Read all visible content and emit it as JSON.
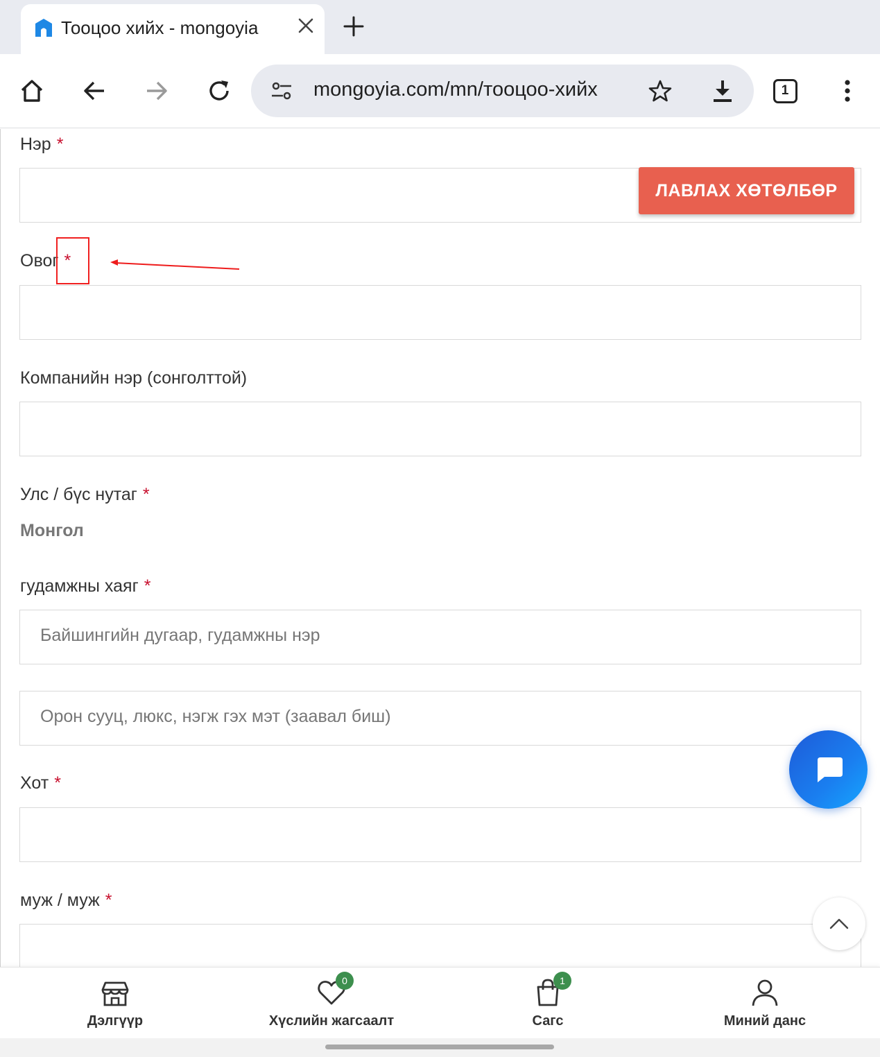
{
  "browser": {
    "tab_title": "Тооцоо хийх - mongoyia",
    "url": "mongoyia.com/mn/тооцоо-хийх",
    "tab_count": "1"
  },
  "form": {
    "first_name_label": "Нэр",
    "required_mark": "*",
    "reference_button": "ЛАВЛАХ ХӨТӨЛБӨР",
    "last_name_label": "Овог",
    "company_label": "Компанийн нэр (сонголттой)",
    "country_label": "Улс / бүс нутаг",
    "country_value": "Монгол",
    "street_label": "гудамжны хаяг",
    "street_placeholder": "Байшингийн дугаар, гудамжны нэр",
    "apartment_placeholder": "Орон сууц, люкс, нэгж гэх мэт (заавал биш)",
    "city_label": "Хот",
    "state_label": "муж / муж"
  },
  "bottom_nav": {
    "shop": "Дэлгүүр",
    "wishlist": "Хүслийн жагсаалт",
    "wishlist_count": "0",
    "cart": "Сагс",
    "cart_count": "1",
    "account": "Миний данс"
  },
  "colors": {
    "accent_button": "#e8604f",
    "required": "#c8102e",
    "badge": "#3d8f4e",
    "chat": "#1a7ff0"
  }
}
